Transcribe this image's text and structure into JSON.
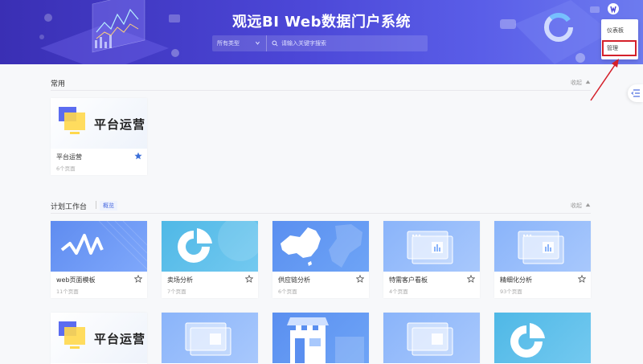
{
  "header": {
    "title": "观远BI Web数据门户系统",
    "search_type": "所有类型",
    "search_placeholder": "请输入关键字搜索"
  },
  "user_menu": {
    "items": [
      "仪表板",
      "管理"
    ],
    "highlighted": "管理"
  },
  "sections": {
    "common": {
      "title": "常用",
      "collapse": "收起",
      "cards": [
        {
          "name": "平台运营",
          "count": "6个页面",
          "thumb_text": "平台运营",
          "starred": true
        }
      ]
    },
    "plan": {
      "title": "计划工作台",
      "tab": "概览",
      "collapse": "收起",
      "cards": [
        {
          "name": "web页面模板",
          "count": "11个页面",
          "thumb": "wave"
        },
        {
          "name": "卖场分析",
          "count": "7个页面",
          "thumb": "pie"
        },
        {
          "name": "供应链分析",
          "count": "6个页面",
          "thumb": "map"
        },
        {
          "name": "特需客户看板",
          "count": "4个页面",
          "thumb": "dashboard"
        },
        {
          "name": "精细化分析",
          "count": "93个页面",
          "thumb": "dashboard"
        }
      ],
      "second_row": [
        {
          "thumb": "platform",
          "thumb_text": "平台运营"
        },
        {
          "thumb": "dashboard"
        },
        {
          "thumb": "store"
        },
        {
          "thumb": "dashboard"
        },
        {
          "thumb": "pie"
        }
      ]
    }
  },
  "colors": {
    "header_start": "#3a2fb4",
    "header_end": "#6d7bef",
    "accent": "#4a6be0",
    "highlight_box": "#d4202a",
    "arrow": "#d4202a",
    "star_active": "#3b6fd8"
  }
}
